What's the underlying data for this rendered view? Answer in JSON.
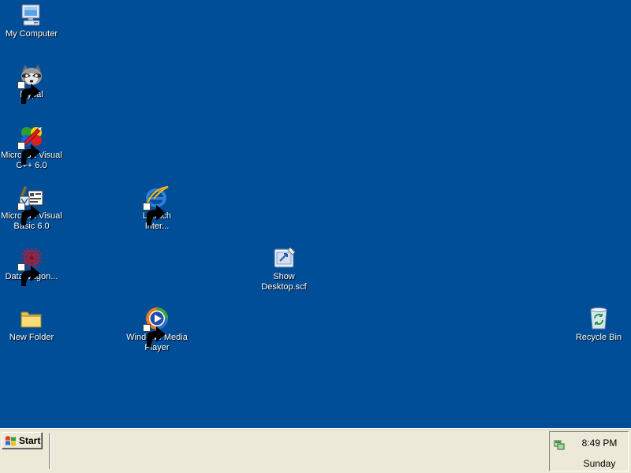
{
  "desktop": {
    "background_color": "#004e98",
    "icons": {
      "my_computer": {
        "label": "My Computer",
        "icon": "my-computer-icon",
        "shortcut": false
      },
      "mypal": {
        "label": "Mypal",
        "icon": "raccoon-icon",
        "shortcut": true
      },
      "visual_cpp": {
        "label": "Microsoft Visual\nC++ 6.0",
        "icon": "visual-cpp-icon",
        "shortcut": true
      },
      "visual_basic": {
        "label": "Microsoft Visual\nBasic 6.0",
        "icon": "visual-basic-icon",
        "shortcut": true
      },
      "launch_ie": {
        "label": "Launch\nInter...",
        "icon": "internet-explorer-icon",
        "shortcut": true
      },
      "datawagon": {
        "label": "DataWagon...",
        "icon": "datawagon-icon",
        "shortcut": true
      },
      "show_desktop": {
        "label": "Show\nDesktop.scf",
        "icon": "show-desktop-icon",
        "shortcut": false
      },
      "new_folder": {
        "label": "New Folder",
        "icon": "folder-icon",
        "shortcut": false
      },
      "windows_media_player": {
        "label": "Windows Media\nPlayer",
        "icon": "media-player-icon",
        "shortcut": true
      },
      "recycle_bin": {
        "label": "Recycle Bin",
        "icon": "recycle-bin-icon",
        "shortcut": false
      }
    }
  },
  "taskbar": {
    "start_label": "Start",
    "tray": {
      "icon": "network-tray-icon",
      "time": "8:49 PM",
      "day": "Sunday"
    }
  }
}
